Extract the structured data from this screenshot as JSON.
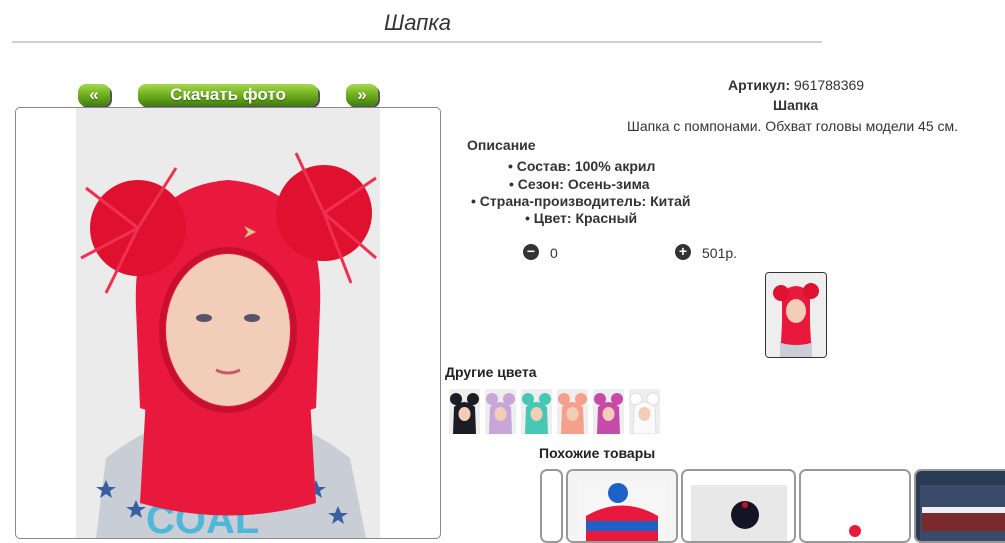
{
  "page": {
    "title": "Шапка"
  },
  "nav": {
    "prev_label": "«",
    "download_label": "Скачать фото",
    "next_label": "»"
  },
  "product": {
    "sku_label": "Артикул:",
    "sku_value": "961788369",
    "name": "Шапка",
    "description": "Шапка с помпонами. Обхват головы модели 45 см.",
    "description_heading": "Описание",
    "specs": [
      "Состав: 100% акрил",
      "Сезон: Осень-зима",
      "Страна-производитель: Китай",
      "Цвет: Красный"
    ],
    "quantity": "0",
    "price": "501р.",
    "color": "#e8193c"
  },
  "other_colors": {
    "heading": "Другие цвета",
    "swatches": [
      "#1c1c24",
      "#c8a6d8",
      "#46c8b4",
      "#f4a08c",
      "#c84aa8",
      "#f2f2f2"
    ]
  },
  "similar": {
    "heading": "Похожие товары"
  },
  "icons": {
    "minus": "minus-circle-icon",
    "plus": "plus-circle-icon"
  }
}
